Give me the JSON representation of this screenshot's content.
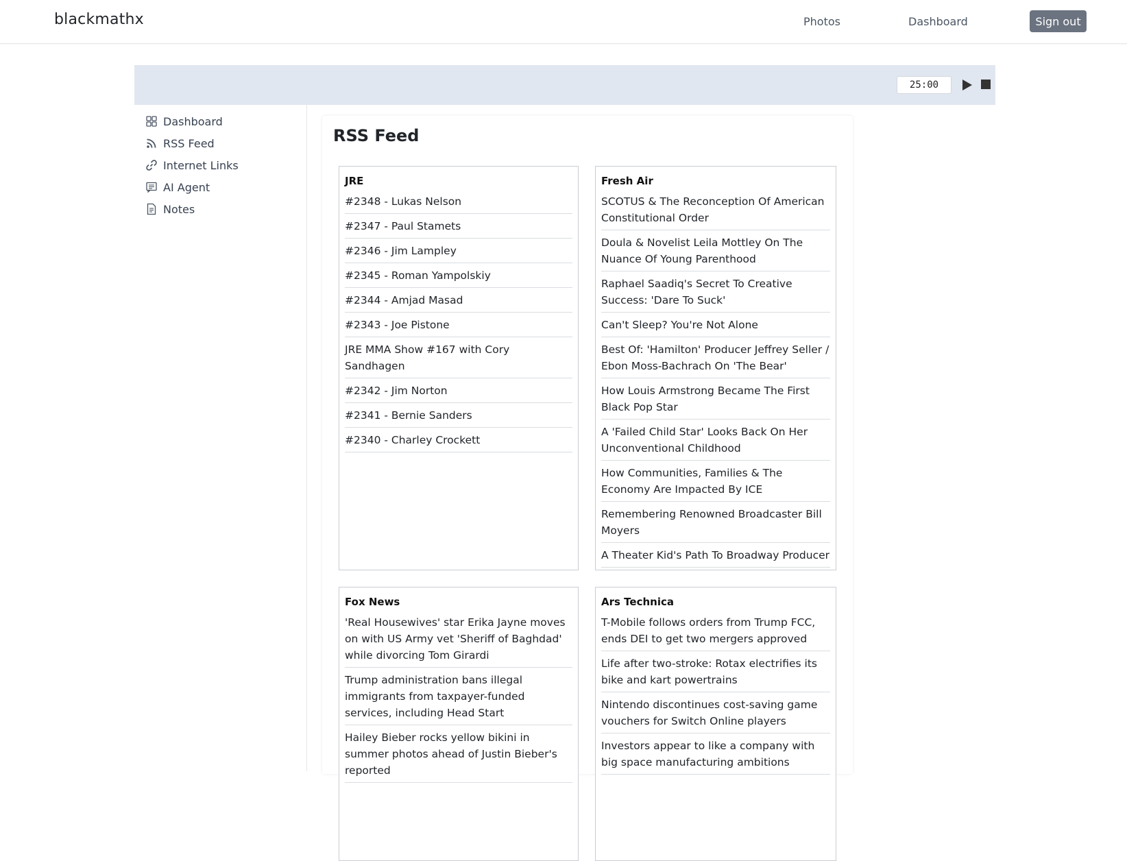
{
  "navbar": {
    "brand": "blackmathx",
    "links": [
      "Photos",
      "Dashboard"
    ],
    "signout_label": "Sign out"
  },
  "timer": {
    "value": "25:00"
  },
  "sidebar": {
    "items": [
      {
        "label": "Dashboard",
        "icon": "grid-icon"
      },
      {
        "label": "RSS Feed",
        "icon": "rss-icon"
      },
      {
        "label": "Internet Links",
        "icon": "link-icon"
      },
      {
        "label": "AI Agent",
        "icon": "chat-icon"
      },
      {
        "label": "Notes",
        "icon": "document-icon"
      }
    ]
  },
  "main": {
    "title": "RSS Feed",
    "feeds": [
      {
        "title": "JRE",
        "items": [
          "#2348 - Lukas Nelson",
          "#2347 - Paul Stamets",
          "#2346 - Jim Lampley",
          "#2345 - Roman Yampolskiy",
          "#2344 - Amjad Masad",
          "#2343 - Joe Pistone",
          "JRE MMA Show #167 with Cory Sandhagen",
          "#2342 - Jim Norton",
          "#2341 - Bernie Sanders",
          "#2340 - Charley Crockett"
        ]
      },
      {
        "title": "Fresh Air",
        "items": [
          "SCOTUS & The Reconception Of American Constitutional Order",
          "Doula & Novelist Leila Mottley On The Nuance Of Young Parenthood",
          "Raphael Saadiq's Secret To Creative Success: 'Dare To Suck'",
          "Can't Sleep? You're Not Alone",
          "Best Of: 'Hamilton' Producer Jeffrey Seller / Ebon Moss-Bachrach On 'The Bear'",
          "How Louis Armstrong Became The First Black Pop Star",
          "A 'Failed Child Star' Looks Back On Her Unconventional Childhood",
          "How Communities, Families & The Economy Are Impacted By ICE",
          "Remembering Renowned Broadcaster Bill Moyers",
          "A Theater Kid's Path To Broadway Producer"
        ]
      },
      {
        "title": "Fox News",
        "items": [
          "'Real Housewives' star Erika Jayne moves on with US Army vet 'Sheriff of Baghdad' while divorcing Tom Girardi",
          "Trump administration bans illegal immigrants from taxpayer-funded services, including Head Start",
          "Hailey Bieber rocks yellow bikini in summer photos ahead of Justin Bieber's reported"
        ]
      },
      {
        "title": "Ars Technica",
        "items": [
          "T-Mobile follows orders from Trump FCC, ends DEI to get two mergers approved",
          "Life after two-stroke: Rotax electrifies its bike and kart powertrains",
          "Nintendo discontinues cost-saving game vouchers for Switch Online players",
          "Investors appear to like a company with big space manufacturing ambitions"
        ]
      }
    ]
  }
}
